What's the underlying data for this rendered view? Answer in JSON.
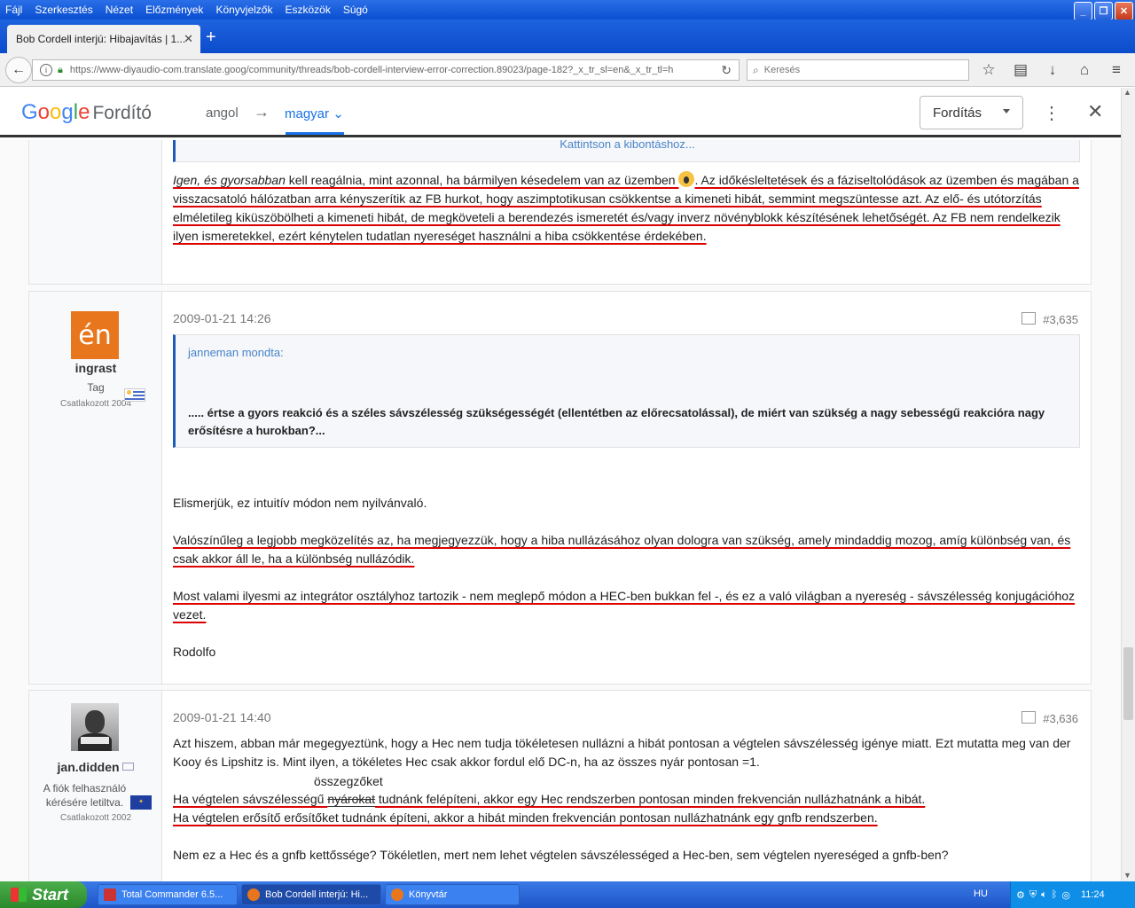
{
  "menubar": [
    "Fájl",
    "Szerkesztés",
    "Nézet",
    "Előzmények",
    "Könyvjelzők",
    "Eszközök",
    "Súgó"
  ],
  "browser": {
    "tab_title": "Bob Cordell interjú: Hibajavítás | 1...",
    "url": "https://www-diyaudio-com.translate.goog/community/threads/bob-cordell-interview-error-correction.89023/page-182?_x_tr_sl=en&_x_tr_tl=h",
    "search_placeholder": "Keresés"
  },
  "translate": {
    "logo_google": [
      "G",
      "o",
      "o",
      "g",
      "l",
      "e"
    ],
    "logo_product": "Fordító",
    "source_lang": "angol",
    "target_lang": "magyar",
    "translate_button": "Fordítás"
  },
  "post1": {
    "expand_link": "Kattintson a kibontáshoz...",
    "text_a": "Igen, és gyorsabban",
    "text_b": " kell reagálnia, mint azonnal, ha bármilyen késedelem van az üzemben ",
    "text_c": ". Az időkésleltetések és a fáziseltolódások az üzemben és magában a visszacsatoló hálózatban arra kényszerítik az FB hurkot, hogy aszimptotikusan csökkentse a kimeneti hibát, semmint megszüntesse azt. Az elő- és utótorzítás elméletileg kiküszöbölheti a kimeneti hibát, de megköveteli a berendezés ismeretét és/vagy inverz növényblokk készítésének lehetőségét. Az FB nem rendelkezik ilyen ismeretekkel, ezért kénytelen tudatlan nyereséget használni a hiba csökkentése érdekében."
  },
  "post2": {
    "avatar_text": "én",
    "username": "ingrast",
    "role": "Tag",
    "joined": "Csatlakozott 2004",
    "date": "2009-01-21 14:26",
    "number": "#3,635",
    "quote_author": "janneman mondta:",
    "quote_text": "..... értse a gyors reakció és a széles sávszélesség szükségességét (ellentétben az előrecsatolással), de miért van szükség a nagy sebességű reakcióra nagy erősítésre a hurokban?...",
    "p1": "Elismerjük, ez intuitív módon nem nyilvánvaló.",
    "p2": "Valószínűleg a legjobb megközelítés az, ha megjegyezzük, hogy a hiba nullázásához olyan dologra van szükség, amely mindaddig mozog, amíg különbség van, és csak akkor áll le, ha a különbség nullázódik.",
    "p3": "Most valami ilyesmi az integrátor osztályhoz tartozik - nem meglepő módon a HEC-ben bukkan fel -, és ez a való világban a nyereség - sávszélesség konjugációhoz vezet.",
    "p4": "Rodolfo"
  },
  "post3": {
    "username": "jan.didden",
    "role": "A fiók felhasználó kérésére letiltva.",
    "joined": "Csatlakozott 2002",
    "date": "2009-01-21 14:40",
    "number": "#3,636",
    "p1": "Azt hiszem, abban már megegyeztünk, hogy a Hec nem tudja tökéletesen nullázni a hibát pontosan a végtelen sávszélesség igénye miatt. Ezt mutatta meg van der Kooy és Lipshitz is. Mint ilyen, a tökéletes Hec csak akkor fordul elő DC-n, ha az összes nyár pontosan =1.",
    "annotation": "összegzőket",
    "p2a": "Ha végtelen sávszélességű ",
    "p2strike": "nyárokat",
    "p2b": " tudnánk felépíteni, akkor egy Hec rendszerben pontosan minden frekvencián nullázhatnánk a hibát.",
    "p3": "Ha végtelen erősítő erősítőket tudnánk építeni, akkor a hibát minden frekvencián pontosan nullázhatnánk egy gnfb rendszerben.",
    "p4": "Nem ez a Hec és a gnfb kettőssége? Tökéletlen, mert nem lehet végtelen sávszélességed a Hec-ben, sem végtelen nyereséged a gnfb-ben?"
  },
  "taskbar": {
    "start": "Start",
    "items": [
      "Total Commander 6.5...",
      "Bob Cordell interjú: Hi...",
      "Könyvtár"
    ],
    "lang": "HU",
    "clock": "11:24"
  }
}
